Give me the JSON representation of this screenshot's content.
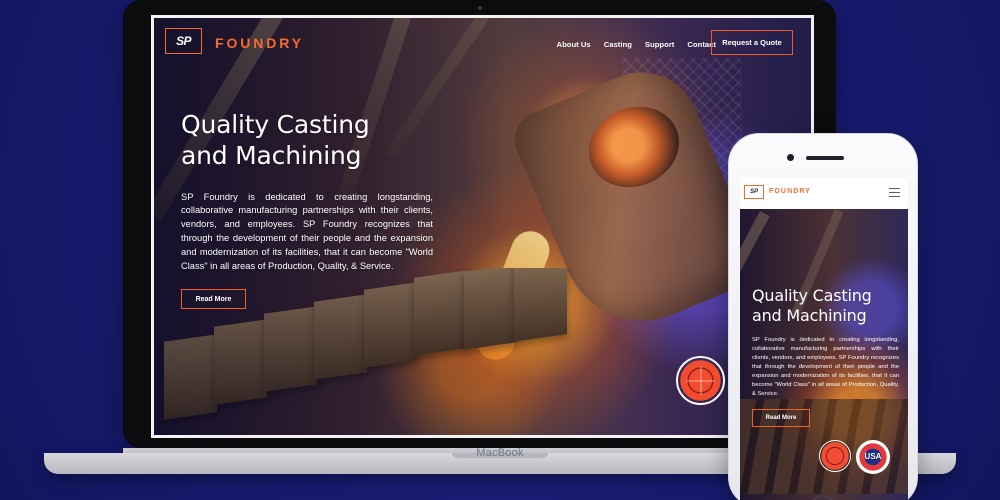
{
  "colors": {
    "page_background": "#171b6f",
    "brand_orange": "#f56b2d",
    "laptop_frame": "#0c0c0f",
    "phone_frame": "#fbfbfd",
    "text_light": "#ffffff"
  },
  "laptop": {
    "brand": "MacBook",
    "site": {
      "logo": {
        "mark": "SP",
        "word": "FOUNDRY"
      },
      "nav": [
        {
          "label": "About Us"
        },
        {
          "label": "Casting"
        },
        {
          "label": "Support"
        },
        {
          "label": "Contact"
        }
      ],
      "cta": "Request a Quote",
      "hero": {
        "title_line_1": "Quality Casting",
        "title_line_2": "and Machining",
        "body": "SP Foundry is dedicated to creating longstanding, collaborative manufacturing partnerships with their clients, vendors, and employees. SP Foundry recognizes that through the development of their people and the expansion and modernization of its facilities, that it can become \"World Class\" in all areas of Production, Quality, & Service.",
        "button": "Read More"
      },
      "badge_icon": "globe-badge-icon"
    }
  },
  "phone": {
    "site": {
      "logo": {
        "mark": "SP",
        "word": "FOUNDRY"
      },
      "menu_icon": "hamburger-menu-icon",
      "hero": {
        "title_line_1": "Quality Casting",
        "title_line_2": "and Machining",
        "body": "SP Foundry is dedicated to creating longstanding, collaborative manufacturing partnerships with their clients, vendors, and employees. SP Foundry recognizes that through the development of their people and the expansion and modernization of its facilities, that it can become \"World Class\" in all areas of Production, Quality, & Service.",
        "button": "Read More"
      },
      "badges": [
        {
          "icon": "globe-badge-icon"
        },
        {
          "icon": "usa-badge-icon",
          "label": "USA"
        }
      ]
    }
  }
}
